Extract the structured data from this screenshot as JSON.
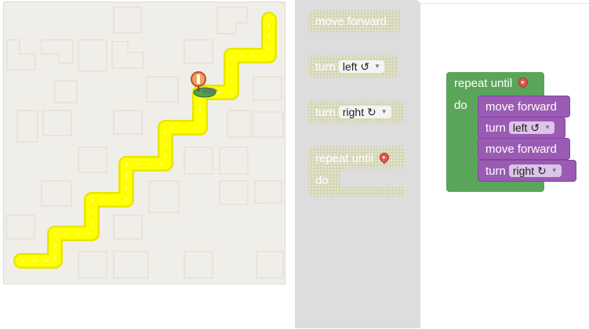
{
  "blocks": {
    "move_forward": "move forward",
    "turn": "turn",
    "left": "left ↺",
    "right": "right ↻",
    "repeat_until": "repeat until",
    "do": "do",
    "dropdown_arrow": "▼"
  },
  "icons": {
    "goal": "map-pin-icon",
    "player": "pegman-icon",
    "dropdown": "chevron-down-icon"
  },
  "colors": {
    "path": "#ffff00",
    "path_border": "#e6e600",
    "maze_bg": "#f0eee8",
    "motion_block": "#9b5bb5",
    "loop_block": "#5ba55b",
    "toolbox_bg": "#dddddd",
    "disabled_block": "#d6d6b8"
  }
}
